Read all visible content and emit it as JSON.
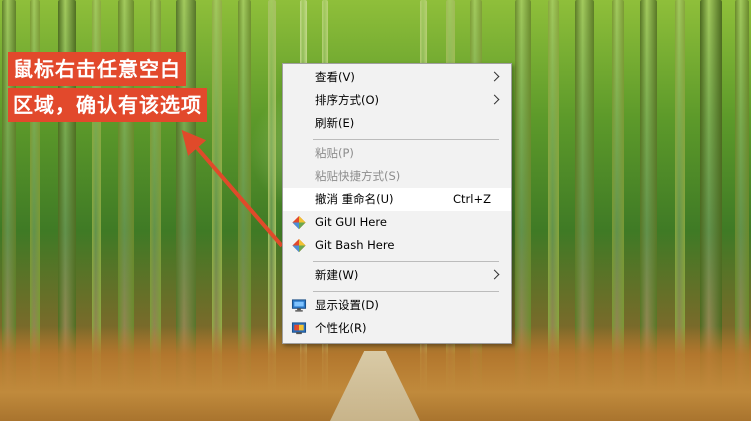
{
  "annotation": {
    "line1": "鼠标右击任意空白",
    "line2": "区域，确认有该选项",
    "bg_color": "#e2492c",
    "arrow_color": "#e04a2a"
  },
  "context_menu": {
    "items": [
      {
        "label": "查看(V)",
        "submenu": true
      },
      {
        "label": "排序方式(O)",
        "submenu": true
      },
      {
        "label": "刷新(E)"
      },
      {
        "label": "粘贴(P)",
        "disabled": true
      },
      {
        "label": "粘贴快捷方式(S)",
        "disabled": true
      },
      {
        "label": "撤消 重命名(U)",
        "shortcut": "Ctrl+Z",
        "highlighted": true
      },
      {
        "label": "Git GUI Here",
        "icon": "git-icon"
      },
      {
        "label": "Git Bash Here",
        "icon": "git-icon"
      },
      {
        "label": "新建(W)",
        "submenu": true
      },
      {
        "label": "显示设置(D)",
        "icon": "display-settings-icon"
      },
      {
        "label": "个性化(R)",
        "icon": "personalize-icon"
      }
    ]
  }
}
